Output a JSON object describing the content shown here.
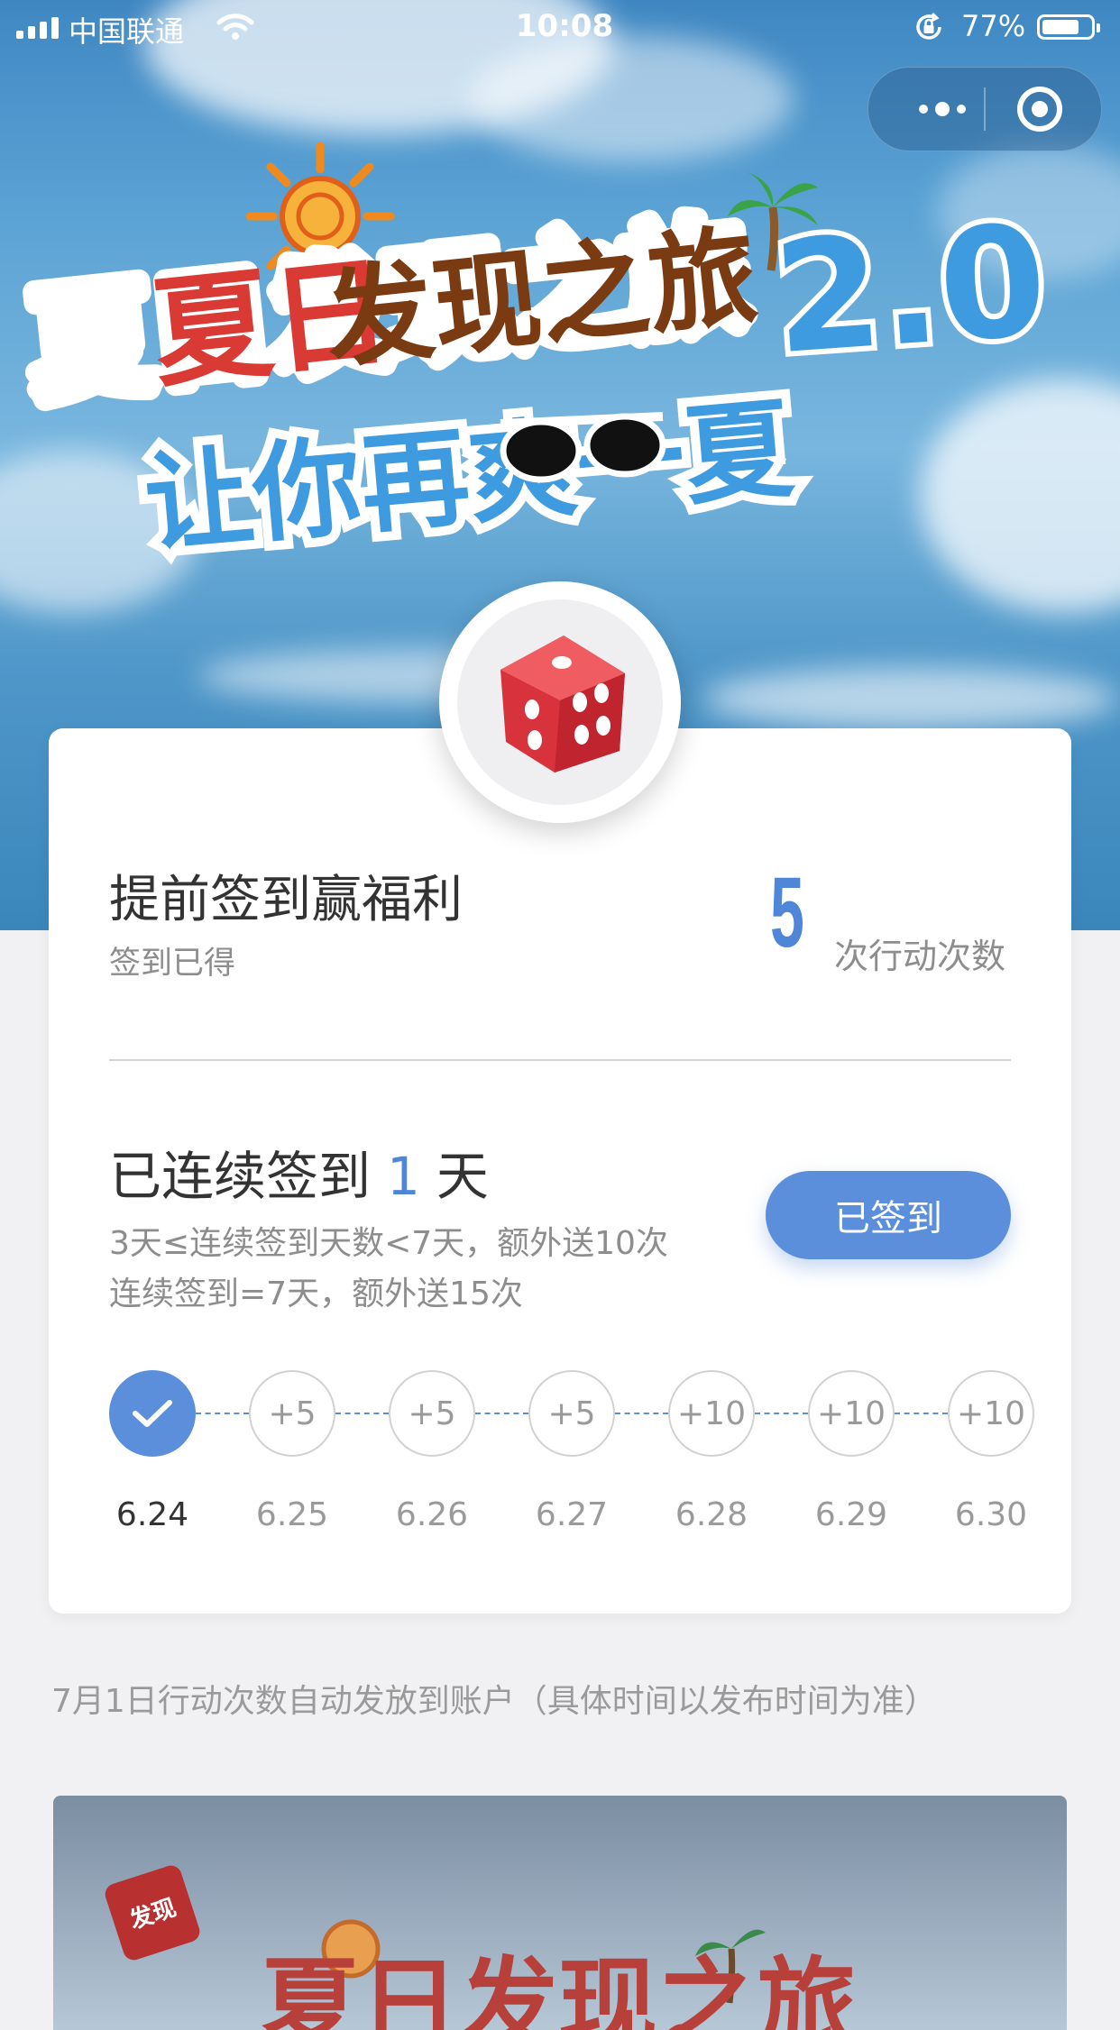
{
  "status_bar": {
    "carrier": "中国联通",
    "time": "10:08",
    "battery_percent": "77%",
    "battery_level": 0.77
  },
  "banner": {
    "line1": "夏日发现之旅",
    "version": "2.0",
    "line2": "让你再爽一夏"
  },
  "card": {
    "title": "提前签到赢福利",
    "subtitle": "签到已得",
    "count": "5",
    "count_label": "次行动次数",
    "streak_prefix": "已连续签到",
    "streak_days": "1",
    "streak_suffix": "天",
    "rule1": "3天≤连续签到天数<7天，额外送10次",
    "rule2": "连续签到=7天，额外送15次",
    "button_label": "已签到",
    "days": [
      {
        "date": "6.24",
        "reward": "",
        "checked": true
      },
      {
        "date": "6.25",
        "reward": "+5",
        "checked": false
      },
      {
        "date": "6.26",
        "reward": "+5",
        "checked": false
      },
      {
        "date": "6.27",
        "reward": "+5",
        "checked": false
      },
      {
        "date": "6.28",
        "reward": "+10",
        "checked": false
      },
      {
        "date": "6.29",
        "reward": "+10",
        "checked": false
      },
      {
        "date": "6.30",
        "reward": "+10",
        "checked": false
      }
    ]
  },
  "footnote": "7月1日行动次数自动发放到账户（具体时间以发布时间为准）",
  "banner2": {
    "dice_text": "发现"
  },
  "colors": {
    "accent": "#5b8fdb",
    "accent_text": "#4f86d8",
    "banner_red": "#d93a34",
    "banner_blue": "#3f9be0",
    "banner_brown": "#7a3a12"
  },
  "icons": [
    "signal-icon",
    "wifi-icon",
    "orientation-lock-icon",
    "battery-icon",
    "more-icon",
    "close-target-icon",
    "dice-icon",
    "check-icon"
  ]
}
